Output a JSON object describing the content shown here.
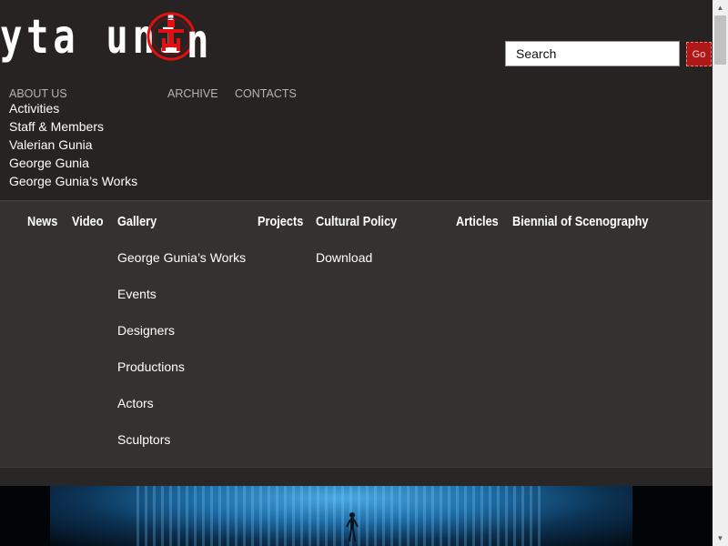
{
  "logo": {
    "text": "yta uni",
    "tail": "n",
    "emblem_color": "#e01010"
  },
  "search": {
    "value": "Search",
    "go_label": "Go"
  },
  "top_nav": {
    "about": "ABOUT US",
    "archive": "ARCHIVE",
    "contacts": "CONTACTS",
    "about_submenu": [
      "Activities",
      "Staff & Members",
      "Valerian Gunia",
      "George Gunia",
      "George Gunia’s Works"
    ]
  },
  "main_nav": {
    "items": [
      "News",
      "Video",
      "Gallery",
      "Projects",
      "Cultural Policy",
      "Articles",
      "Biennial of Scenography"
    ],
    "gallery_submenu": [
      "George Gunia’s Works",
      "Events",
      "Designers",
      "Productions",
      "Actors",
      "Sculptors"
    ],
    "cultural_policy_submenu": [
      "Download"
    ]
  },
  "scrollbar": {
    "up_icon": "▲",
    "down_icon": "▼"
  }
}
